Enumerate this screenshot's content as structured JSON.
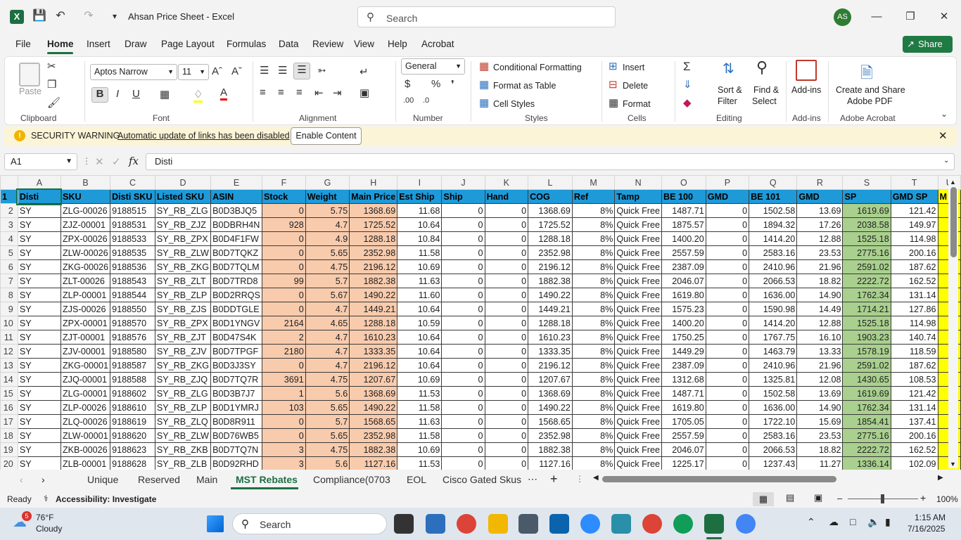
{
  "app": {
    "title": "Ahsan Price Sheet  -  Excel",
    "logo": "X",
    "search_placeholder": "Search",
    "avatar": "AS",
    "accent": "#1d6f42"
  },
  "icons": {
    "save": "save-icon",
    "undo": "undo-icon",
    "redo": "redo-icon",
    "customize": "customize-qat-icon",
    "search": "search-icon",
    "minimize": "minimize-icon",
    "maximize": "maximize-icon",
    "close": "close-icon"
  },
  "menu": {
    "file": "File",
    "home": "Home",
    "insert": "Insert",
    "draw": "Draw",
    "page_layout": "Page Layout",
    "formulas": "Formulas",
    "data": "Data",
    "review": "Review",
    "view": "View",
    "help": "Help",
    "acrobat": "Acrobat",
    "share": "Share"
  },
  "ribbon": {
    "clipboard": {
      "label": "Clipboard",
      "paste": "Paste"
    },
    "font": {
      "label": "Font",
      "name": "Aptos Narrow",
      "size": "11"
    },
    "alignment": {
      "label": "Alignment"
    },
    "number": {
      "label": "Number",
      "format": "General"
    },
    "styles": {
      "label": "Styles",
      "conditional": "Conditional Formatting",
      "table": "Format as Table",
      "cell": "Cell Styles"
    },
    "cells": {
      "label": "Cells",
      "insert": "Insert",
      "delete": "Delete",
      "format": "Format"
    },
    "editing": {
      "label": "Editing",
      "sort1": "Sort &",
      "sort2": "Filter",
      "find1": "Find &",
      "find2": "Select"
    },
    "addins": {
      "label": "Add-ins",
      "btn": "Add-ins"
    },
    "acrobat": {
      "label": "Adobe Acrobat",
      "line1": "Create and Share",
      "line2": "Adobe PDF"
    }
  },
  "security": {
    "title": "SECURITY WARNING",
    "message": "Automatic update of links has been disabled",
    "button": "Enable Content"
  },
  "formula": {
    "cell": "A1",
    "fx": "fx",
    "value": "Disti"
  },
  "grid": {
    "columns": [
      "A",
      "B",
      "C",
      "D",
      "E",
      "F",
      "G",
      "H",
      "I",
      "J",
      "K",
      "L",
      "M",
      "N",
      "O",
      "P",
      "Q",
      "R",
      "S",
      "T",
      "U"
    ],
    "header": [
      "Disti",
      "SKU",
      "Disti SKU",
      "Listed SKU",
      "ASIN",
      "Stock",
      "Weight",
      "Main Price",
      "Est Ship",
      "Ship",
      "Hand",
      "COG",
      "Ref",
      "Tamp",
      "BE 100",
      "GMD",
      "BE 101",
      "GMD",
      "SP",
      "GMD SP",
      "M"
    ],
    "rows": [
      [
        "SY",
        "ZLG-00026",
        "9188515",
        "SY_RB_ZLG",
        "B0D3BJQ5",
        "0",
        "5.75",
        "1368.69",
        "11.68",
        "0",
        "0",
        "1368.69",
        "8%",
        "Quick Free",
        "1487.71",
        "0",
        "1502.58",
        "13.69",
        "1619.69",
        "121.42",
        ""
      ],
      [
        "SY",
        "ZJZ-00001",
        "9188531",
        "SY_RB_ZJZ",
        "B0DBRH4N",
        "928",
        "4.7",
        "1725.52",
        "10.64",
        "0",
        "0",
        "1725.52",
        "8%",
        "Quick Free",
        "1875.57",
        "0",
        "1894.32",
        "17.26",
        "2038.58",
        "149.97",
        ""
      ],
      [
        "SY",
        "ZPX-00026",
        "9188533",
        "SY_RB_ZPX",
        "B0D4F1FW",
        "0",
        "4.9",
        "1288.18",
        "10.84",
        "0",
        "0",
        "1288.18",
        "8%",
        "Quick Free",
        "1400.20",
        "0",
        "1414.20",
        "12.88",
        "1525.18",
        "114.98",
        ""
      ],
      [
        "SY",
        "ZLW-00026",
        "9188535",
        "SY_RB_ZLW",
        "B0D7TQKZ",
        "0",
        "5.65",
        "2352.98",
        "11.58",
        "0",
        "0",
        "2352.98",
        "8%",
        "Quick Free",
        "2557.59",
        "0",
        "2583.16",
        "23.53",
        "2775.16",
        "200.16",
        ""
      ],
      [
        "SY",
        "ZKG-00026",
        "9188536",
        "SY_RB_ZKG",
        "B0D7TQLM",
        "0",
        "4.75",
        "2196.12",
        "10.69",
        "0",
        "0",
        "2196.12",
        "8%",
        "Quick Free",
        "2387.09",
        "0",
        "2410.96",
        "21.96",
        "2591.02",
        "187.62",
        ""
      ],
      [
        "SY",
        "ZLT-00026",
        "9188543",
        "SY_RB_ZLT",
        "B0D7TRD8",
        "99",
        "5.7",
        "1882.38",
        "11.63",
        "0",
        "0",
        "1882.38",
        "8%",
        "Quick Free",
        "2046.07",
        "0",
        "2066.53",
        "18.82",
        "2222.72",
        "162.52",
        ""
      ],
      [
        "SY",
        "ZLP-00001",
        "9188544",
        "SY_RB_ZLP",
        "B0D2RRQS",
        "0",
        "5.67",
        "1490.22",
        "11.60",
        "0",
        "0",
        "1490.22",
        "8%",
        "Quick Free",
        "1619.80",
        "0",
        "1636.00",
        "14.90",
        "1762.34",
        "131.14",
        ""
      ],
      [
        "SY",
        "ZJS-00026",
        "9188550",
        "SY_RB_ZJS",
        "B0DDTGLE",
        "0",
        "4.7",
        "1449.21",
        "10.64",
        "0",
        "0",
        "1449.21",
        "8%",
        "Quick Free",
        "1575.23",
        "0",
        "1590.98",
        "14.49",
        "1714.21",
        "127.86",
        ""
      ],
      [
        "SY",
        "ZPX-00001",
        "9188570",
        "SY_RB_ZPX",
        "B0D1YNGV",
        "2164",
        "4.65",
        "1288.18",
        "10.59",
        "0",
        "0",
        "1288.18",
        "8%",
        "Quick Free",
        "1400.20",
        "0",
        "1414.20",
        "12.88",
        "1525.18",
        "114.98",
        ""
      ],
      [
        "SY",
        "ZJT-00001",
        "9188576",
        "SY_RB_ZJT",
        "B0D47S4K",
        "2",
        "4.7",
        "1610.23",
        "10.64",
        "0",
        "0",
        "1610.23",
        "8%",
        "Quick Free",
        "1750.25",
        "0",
        "1767.75",
        "16.10",
        "1903.23",
        "140.74",
        ""
      ],
      [
        "SY",
        "ZJV-00001",
        "9188580",
        "SY_RB_ZJV",
        "B0D7TPGF",
        "2180",
        "4.7",
        "1333.35",
        "10.64",
        "0",
        "0",
        "1333.35",
        "8%",
        "Quick Free",
        "1449.29",
        "0",
        "1463.79",
        "13.33",
        "1578.19",
        "118.59",
        ""
      ],
      [
        "SY",
        "ZKG-00001",
        "9188587",
        "SY_RB_ZKG",
        "B0D3J3SY",
        "0",
        "4.7",
        "2196.12",
        "10.64",
        "0",
        "0",
        "2196.12",
        "8%",
        "Quick Free",
        "2387.09",
        "0",
        "2410.96",
        "21.96",
        "2591.02",
        "187.62",
        ""
      ],
      [
        "SY",
        "ZJQ-00001",
        "9188588",
        "SY_RB_ZJQ",
        "B0D7TQ7R",
        "3691",
        "4.75",
        "1207.67",
        "10.69",
        "0",
        "0",
        "1207.67",
        "8%",
        "Quick Free",
        "1312.68",
        "0",
        "1325.81",
        "12.08",
        "1430.65",
        "108.53",
        ""
      ],
      [
        "SY",
        "ZLG-00001",
        "9188602",
        "SY_RB_ZLG",
        "B0D3B7J7",
        "1",
        "5.6",
        "1368.69",
        "11.53",
        "0",
        "0",
        "1368.69",
        "8%",
        "Quick Free",
        "1487.71",
        "0",
        "1502.58",
        "13.69",
        "1619.69",
        "121.42",
        ""
      ],
      [
        "SY",
        "ZLP-00026",
        "9188610",
        "SY_RB_ZLP",
        "B0D1YMRJ",
        "103",
        "5.65",
        "1490.22",
        "11.58",
        "0",
        "0",
        "1490.22",
        "8%",
        "Quick Free",
        "1619.80",
        "0",
        "1636.00",
        "14.90",
        "1762.34",
        "131.14",
        ""
      ],
      [
        "SY",
        "ZLQ-00026",
        "9188619",
        "SY_RB_ZLQ",
        "B0D8R911",
        "0",
        "5.7",
        "1568.65",
        "11.63",
        "0",
        "0",
        "1568.65",
        "8%",
        "Quick Free",
        "1705.05",
        "0",
        "1722.10",
        "15.69",
        "1854.41",
        "137.41",
        ""
      ],
      [
        "SY",
        "ZLW-00001",
        "9188620",
        "SY_RB_ZLW",
        "B0D76WB5",
        "0",
        "5.65",
        "2352.98",
        "11.58",
        "0",
        "0",
        "2352.98",
        "8%",
        "Quick Free",
        "2557.59",
        "0",
        "2583.16",
        "23.53",
        "2775.16",
        "200.16",
        ""
      ],
      [
        "SY",
        "ZKB-00026",
        "9188623",
        "SY_RB_ZKB",
        "B0D7TQ7N",
        "3",
        "4.75",
        "1882.38",
        "10.69",
        "0",
        "0",
        "1882.38",
        "8%",
        "Quick Free",
        "2046.07",
        "0",
        "2066.53",
        "18.82",
        "2222.72",
        "162.52",
        ""
      ],
      [
        "SY",
        "ZLB-00001",
        "9188628",
        "SY_RB_ZLB",
        "B0D92RHD",
        "3",
        "5.6",
        "1127.16",
        "11.53",
        "0",
        "0",
        "1127.16",
        "8%",
        "Quick Free",
        "1225.17",
        "0",
        "1237.43",
        "11.27",
        "1336.14",
        "102.09",
        ""
      ]
    ]
  },
  "sheets": [
    "Unique",
    "Reserved",
    "Main",
    "MST Rebates",
    "Compliance(0703",
    "EOL",
    "Cisco Gated Skus"
  ],
  "status": {
    "ready": "Ready",
    "accessibility": "Accessibility: Investigate",
    "zoom": "100%"
  },
  "taskbar": {
    "weather_temp": "76°F",
    "weather_desc": "Cloudy",
    "weather_badge": "5",
    "search": "Search",
    "time": "1:15 AM",
    "date": "7/16/2025"
  }
}
